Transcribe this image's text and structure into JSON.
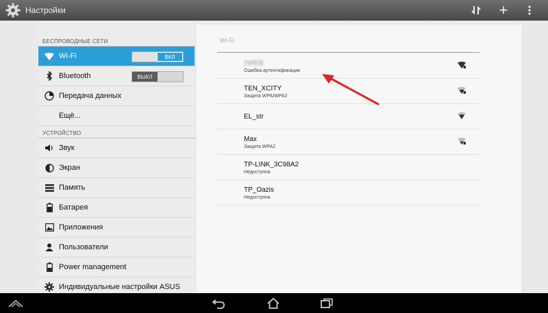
{
  "header": {
    "title": "Настройки",
    "icons": {
      "app": "gear-icon",
      "sync": "sync-icon",
      "add": "plus-icon",
      "more": "overflow-menu-icon"
    },
    "add_label": "+"
  },
  "sidebar": {
    "sections": {
      "wireless": "Беспроводные сети",
      "device": "Устройство"
    },
    "wifi": {
      "label": "Wi-Fi",
      "toggle": "ВКЛ",
      "icon": "wifi-icon"
    },
    "bluetooth": {
      "label": "Bluetooth",
      "toggle": "ВЫКЛ",
      "icon": "bluetooth-icon"
    },
    "data": {
      "label": "Передача данных",
      "icon": "data-usage-icon"
    },
    "more": {
      "label": "Ещё..."
    },
    "sound": {
      "label": "Звук",
      "icon": "sound-icon"
    },
    "display": {
      "label": "Экран",
      "icon": "display-icon"
    },
    "storage": {
      "label": "Память",
      "icon": "storage-icon"
    },
    "battery": {
      "label": "Батарея",
      "icon": "battery-icon"
    },
    "apps": {
      "label": "Приложения",
      "icon": "apps-icon"
    },
    "users": {
      "label": "Пользователи",
      "icon": "users-icon"
    },
    "power": {
      "label": "Power management",
      "icon": "power-icon"
    },
    "asus": {
      "label": "Индивидуальные настройки ASUS",
      "icon": "wrench-icon"
    }
  },
  "main": {
    "title": "Wi-Fi",
    "networks": [
      {
        "ssid": "2WEB",
        "status": "Ошибка аутентификации"
      },
      {
        "ssid": "TEN_XCITY",
        "status": "Защита WPA/WPA2"
      },
      {
        "ssid": "EL_str",
        "status": ""
      },
      {
        "ssid": "Max",
        "status": "Защита WPA2"
      },
      {
        "ssid": "TP-LINK_3C98A2",
        "status": "Недоступна"
      },
      {
        "ssid": "TP_Oazis",
        "status": "Недоступна"
      }
    ]
  },
  "colors": {
    "accent": "#2b9fd9",
    "arrow": "#d8262c",
    "actionbar": "#5a5a5a"
  },
  "navbar": {
    "icons": [
      "menu-icon",
      "back-icon",
      "home-icon",
      "recent-apps-icon"
    ]
  }
}
